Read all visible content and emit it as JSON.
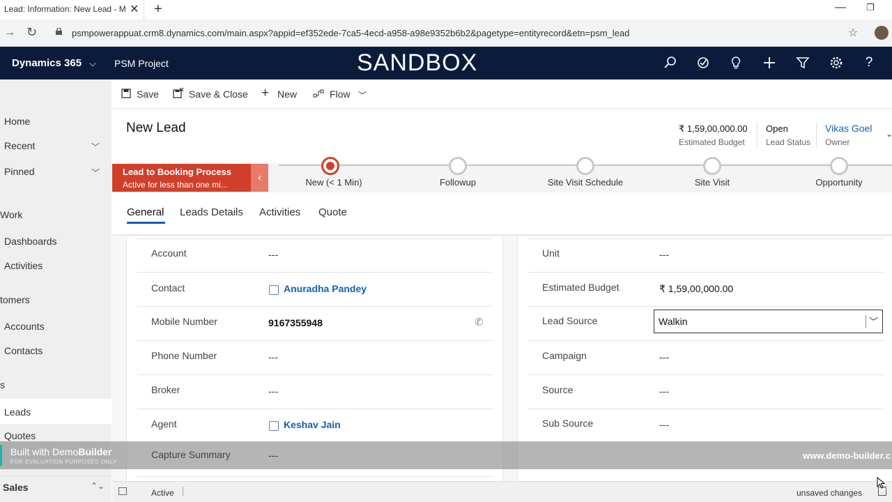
{
  "browser": {
    "tab_title": "Lead: Information: New Lead - M",
    "close_glyph": "✕",
    "new_tab_glyph": "+",
    "url": "psmpowerappuat.crm8.dynamics.com/main.aspx?appid=ef352ede-7ca5-4ecd-a958-a98e9352b6b2&pagetype=entityrecord&etn=psm_lead"
  },
  "app_header": {
    "brand": "Dynamics 365",
    "app_name": "PSM Project",
    "environment_banner": "SANDBOX",
    "icons": [
      "search-icon",
      "assistant-icon",
      "lightbulb-icon",
      "plus-icon",
      "filter-icon",
      "settings-icon",
      "help-icon"
    ]
  },
  "sitemap": {
    "items": [
      {
        "label": "Home"
      },
      {
        "label": "Recent"
      },
      {
        "label": "Pinned"
      }
    ],
    "groups": [
      {
        "label": "Work",
        "items": [
          "Dashboards",
          "Activities"
        ]
      },
      {
        "label": "tomers",
        "items": [
          "Accounts",
          "Contacts"
        ]
      },
      {
        "label": "s",
        "items": [
          "Leads",
          "Quotes"
        ]
      }
    ],
    "area": "Sales"
  },
  "command_bar": {
    "save": "Save",
    "save_close": "Save & Close",
    "new": "New",
    "flow": "Flow"
  },
  "form_header": {
    "title": "New Lead",
    "estimated_budget": {
      "value": "₹ 1,59,00,000.00",
      "label": "Estimated Budget"
    },
    "lead_status": {
      "value": "Open",
      "label": "Lead Status"
    },
    "owner": {
      "value": "Vikas Goel",
      "label": "Owner"
    }
  },
  "bpf": {
    "process_name": "Lead to Booking Process",
    "duration": "Active for less than one mi...",
    "stages": [
      {
        "label": "New  (< 1 Min)",
        "active": true
      },
      {
        "label": "Followup",
        "active": false
      },
      {
        "label": "Site Visit Schedule",
        "active": false
      },
      {
        "label": "Site Visit",
        "active": false
      },
      {
        "label": "Opportunity",
        "active": false
      }
    ],
    "active_color": "#d13f2a"
  },
  "tabs": [
    "General",
    "Leads Details",
    "Activities",
    "Quote"
  ],
  "left_fields": [
    {
      "label": "Account",
      "value": "---"
    },
    {
      "label": "Contact",
      "value": "Anuradha Pandey"
    },
    {
      "label": "Mobile Number",
      "value": "9167355948"
    },
    {
      "label": "Phone Number",
      "value": "---"
    },
    {
      "label": "Broker",
      "value": "---"
    },
    {
      "label": "Agent",
      "value": "Keshav Jain"
    },
    {
      "label": "Capture Summary",
      "value": "---"
    }
  ],
  "right_fields": [
    {
      "label": "Unit",
      "value": "---"
    },
    {
      "label": "Estimated Budget",
      "value": "₹ 1,59,00,000.00"
    },
    {
      "label": "Lead Source",
      "value": "Walkin"
    },
    {
      "label": "Campaign",
      "value": "---"
    },
    {
      "label": "Source",
      "value": "---"
    },
    {
      "label": "Sub Source",
      "value": "---"
    }
  ],
  "watermark": {
    "title_prefix": "Built with Demo",
    "title_bold": "Builder",
    "subtitle": "FOR EVALUATION PURPOSES ONLY",
    "url": "www.demo-builder.c"
  },
  "footer": {
    "status": "Active",
    "unsaved": "unsaved changes"
  },
  "colors": {
    "app_bar": "#0b1b3b",
    "link": "#1160b7"
  }
}
